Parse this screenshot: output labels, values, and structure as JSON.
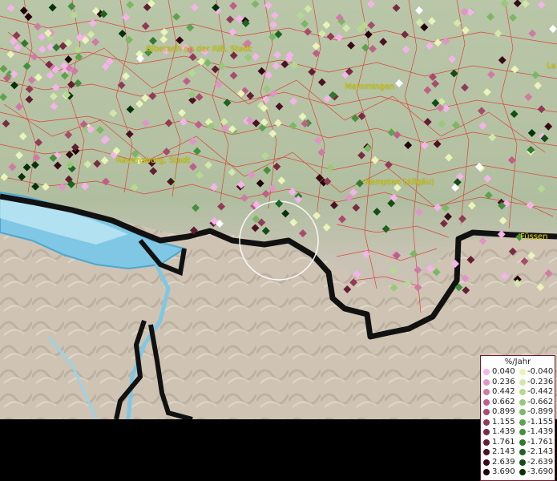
{
  "map": {
    "places": [
      {
        "name": "Biberach an der Riß, Stadt"
      },
      {
        "name": "Memmingen"
      },
      {
        "name": "Ravensburg, Stadt"
      },
      {
        "name": "Kempten (Allgäu)"
      },
      {
        "name": "Füssen"
      },
      {
        "name": "La"
      }
    ],
    "colors": {
      "boundary": "#e0302a",
      "lake": "#7fc7e4",
      "border": "#111111",
      "highlight_circle": "#ffffff"
    }
  },
  "legend": {
    "title": "%/Jahr",
    "positive": [
      {
        "label": "0.040",
        "color": "#f4b4ea"
      },
      {
        "label": "0.236",
        "color": "#e094c8"
      },
      {
        "label": "0.442",
        "color": "#d07aa6"
      },
      {
        "label": "0.662",
        "color": "#bf5f88"
      },
      {
        "label": "0.899",
        "color": "#a84c6c"
      },
      {
        "label": "1.155",
        "color": "#913b56"
      },
      {
        "label": "1.439",
        "color": "#7a2b42"
      },
      {
        "label": "1.761",
        "color": "#631e33"
      },
      {
        "label": "2.143",
        "color": "#4c1124"
      },
      {
        "label": "2.639",
        "color": "#380817"
      },
      {
        "label": "3.690",
        "color": "#22020b"
      }
    ],
    "negative": [
      {
        "label": "-0.040",
        "color": "#eaf4b8"
      },
      {
        "label": "-0.236",
        "color": "#d1e8a8"
      },
      {
        "label": "-0.442",
        "color": "#b5d98e"
      },
      {
        "label": "-0.662",
        "color": "#98c978"
      },
      {
        "label": "-0.899",
        "color": "#7bb863"
      },
      {
        "label": "-1.155",
        "color": "#5da34e"
      },
      {
        "label": "-1.439",
        "color": "#458f3d"
      },
      {
        "label": "-1.761",
        "color": "#307a2e"
      },
      {
        "label": "-2.143",
        "color": "#1e6421"
      },
      {
        "label": "-2.639",
        "color": "#114d15"
      },
      {
        "label": "-3.690",
        "color": "#05320a"
      }
    ]
  }
}
